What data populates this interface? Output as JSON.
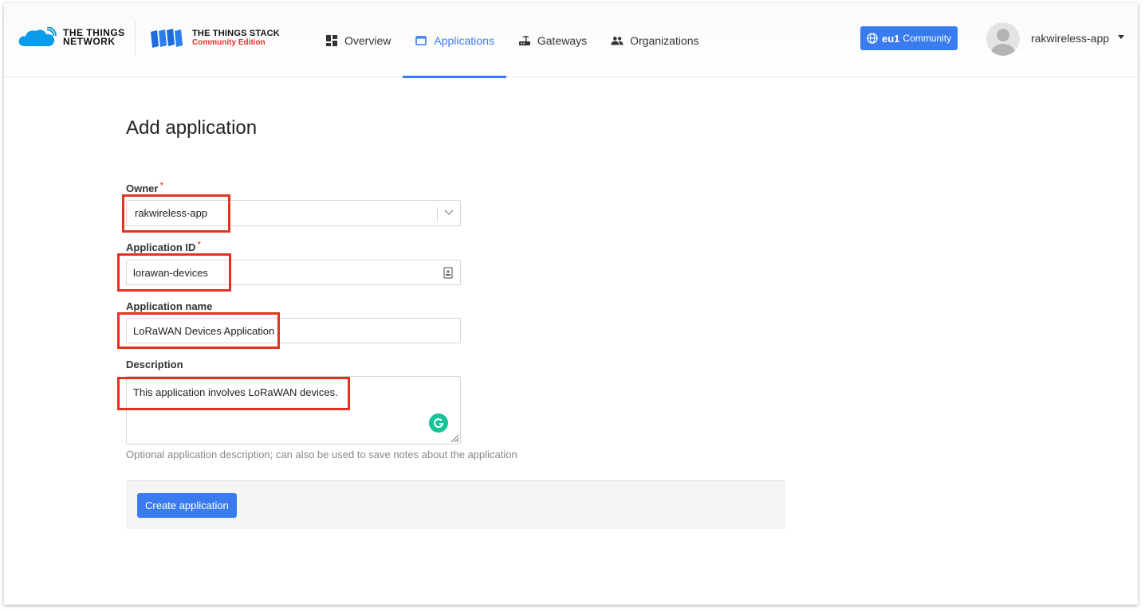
{
  "header": {
    "ttn_line1": "THE THINGS",
    "ttn_line2": "NETWORK",
    "tts_line1": "THE THINGS STACK",
    "tts_line2": "Community Edition",
    "nav": [
      {
        "label": "Overview",
        "icon": "dashboard-icon"
      },
      {
        "label": "Applications",
        "icon": "application-icon",
        "active": true
      },
      {
        "label": "Gateways",
        "icon": "router-icon"
      },
      {
        "label": "Organizations",
        "icon": "people-icon"
      }
    ],
    "cluster": {
      "region": "eu1",
      "label": "Community",
      "icon": "globe-icon"
    },
    "user": {
      "name": "rakwireless-app"
    }
  },
  "page": {
    "title": "Add application"
  },
  "form": {
    "owner": {
      "label": "Owner",
      "required": "*",
      "value": "rakwireless-app"
    },
    "app_id": {
      "label": "Application ID",
      "required": "*",
      "value": "lorawan-devices"
    },
    "app_name": {
      "label": "Application name",
      "value": "LoRaWAN Devices Application"
    },
    "description": {
      "label": "Description",
      "value": "This application involves LoRaWAN devices.",
      "hint": "Optional application description; can also be used to save notes about the application"
    },
    "submit_label": "Create application"
  },
  "colors": {
    "accent": "#3a7cf0",
    "annotation": "#e5321f",
    "required": "#e0362e",
    "grammarly": "#15c39a"
  }
}
